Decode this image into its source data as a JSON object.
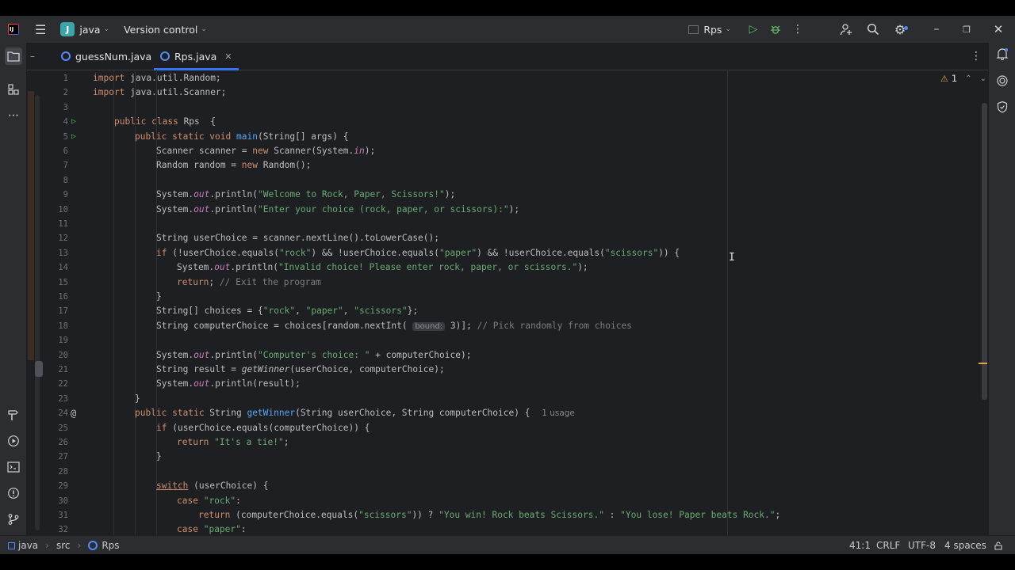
{
  "titlebar": {
    "app_icon_text": "IJ",
    "project_badge": "J",
    "project_name": "java",
    "vcs_label": "Version control",
    "run_config": "Rps"
  },
  "tabs": [
    {
      "label": "guessNum.java",
      "active": false
    },
    {
      "label": "Rps.java",
      "active": true
    }
  ],
  "inspections": {
    "warnings": "1"
  },
  "code": [
    {
      "n": "1",
      "text": "import java.util.Random;"
    },
    {
      "n": "2",
      "text": "import java.util.Scanner;"
    },
    {
      "n": "3",
      "text": ""
    },
    {
      "n": "4",
      "text": "public class Rps  {"
    },
    {
      "n": "5",
      "text": "public static void main(String[] args) {"
    },
    {
      "n": "6",
      "text": "Scanner scanner = new Scanner(System.in);"
    },
    {
      "n": "7",
      "text": "Random random = new Random();"
    },
    {
      "n": "8",
      "text": ""
    },
    {
      "n": "9",
      "text": "System.out.println(\"Welcome to Rock, Paper, Scissors!\");"
    },
    {
      "n": "10",
      "text": "System.out.println(\"Enter your choice (rock, paper, or scissors):\");"
    },
    {
      "n": "11",
      "text": ""
    },
    {
      "n": "12",
      "text": "String userChoice = scanner.nextLine().toLowerCase();"
    },
    {
      "n": "13",
      "text": "if (!userChoice.equals(\"rock\") && !userChoice.equals(\"paper\") && !userChoice.equals(\"scissors\")) {"
    },
    {
      "n": "14",
      "text": "System.out.println(\"Invalid choice! Please enter rock, paper, or scissors.\");"
    },
    {
      "n": "15",
      "text": "return; // Exit the program"
    },
    {
      "n": "16",
      "text": "}"
    },
    {
      "n": "17",
      "text": "String[] choices = {\"rock\", \"paper\", \"scissors\"};"
    },
    {
      "n": "18",
      "text": "String computerChoice = choices[random.nextInt( bound: 3)]; // Pick randomly from choices"
    },
    {
      "n": "19",
      "text": ""
    },
    {
      "n": "20",
      "text": "System.out.println(\"Computer's choice: \" + computerChoice);"
    },
    {
      "n": "21",
      "text": "String result = getWinner(userChoice, computerChoice);"
    },
    {
      "n": "22",
      "text": "System.out.println(result);"
    },
    {
      "n": "23",
      "text": "}"
    },
    {
      "n": "24",
      "text": "public static String getWinner(String userChoice, String computerChoice) {  1 usage"
    },
    {
      "n": "25",
      "text": "if (userChoice.equals(computerChoice)) {"
    },
    {
      "n": "26",
      "text": "return \"It's a tie!\";"
    },
    {
      "n": "27",
      "text": "}"
    },
    {
      "n": "28",
      "text": ""
    },
    {
      "n": "29",
      "text": "switch (userChoice) {"
    },
    {
      "n": "30",
      "text": "case \"rock\":"
    },
    {
      "n": "31",
      "text": "return (computerChoice.equals(\"scissors\")) ? \"You win! Rock beats Scissors.\" : \"You lose! Paper beats Rock.\";"
    },
    {
      "n": "32",
      "text": "case \"paper\":"
    }
  ],
  "statusbar": {
    "crumb1": "java",
    "crumb2": "src",
    "crumb3": "Rps",
    "position": "41:1",
    "line_sep": "CRLF",
    "encoding": "UTF-8",
    "indent": "4 spaces"
  },
  "colors": {
    "accent": "#3574f0",
    "keyword": "#cf8e6d",
    "string": "#6aab73",
    "method": "#56a8f5",
    "static_field": "#c77dbb"
  }
}
